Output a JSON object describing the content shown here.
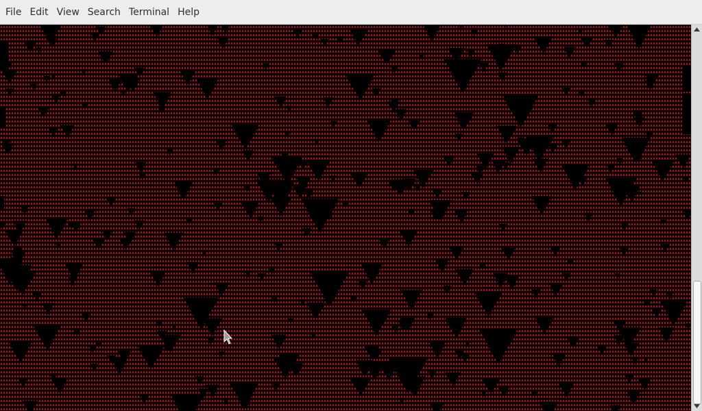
{
  "menubar": {
    "items": [
      {
        "label": "File"
      },
      {
        "label": "Edit"
      },
      {
        "label": "View"
      },
      {
        "label": "Search"
      },
      {
        "label": "Terminal"
      },
      {
        "label": "Help"
      }
    ]
  },
  "terminal": {
    "output_description_glyph": "▲",
    "foreground_color": "#c8141e",
    "background_color": "#000000"
  },
  "scrollbar": {
    "position_fraction": 0.68,
    "up_icon": "triangle-up-icon",
    "down_icon": "triangle-down-icon"
  },
  "pointer": {
    "icon": "mouse-pointer-icon"
  },
  "colors": {
    "menubar_bg": "#ededed",
    "menu_text": "#2e2e2e",
    "scroll_track": "#dcdcdc",
    "scroll_thumb": "#f7f7f7"
  }
}
